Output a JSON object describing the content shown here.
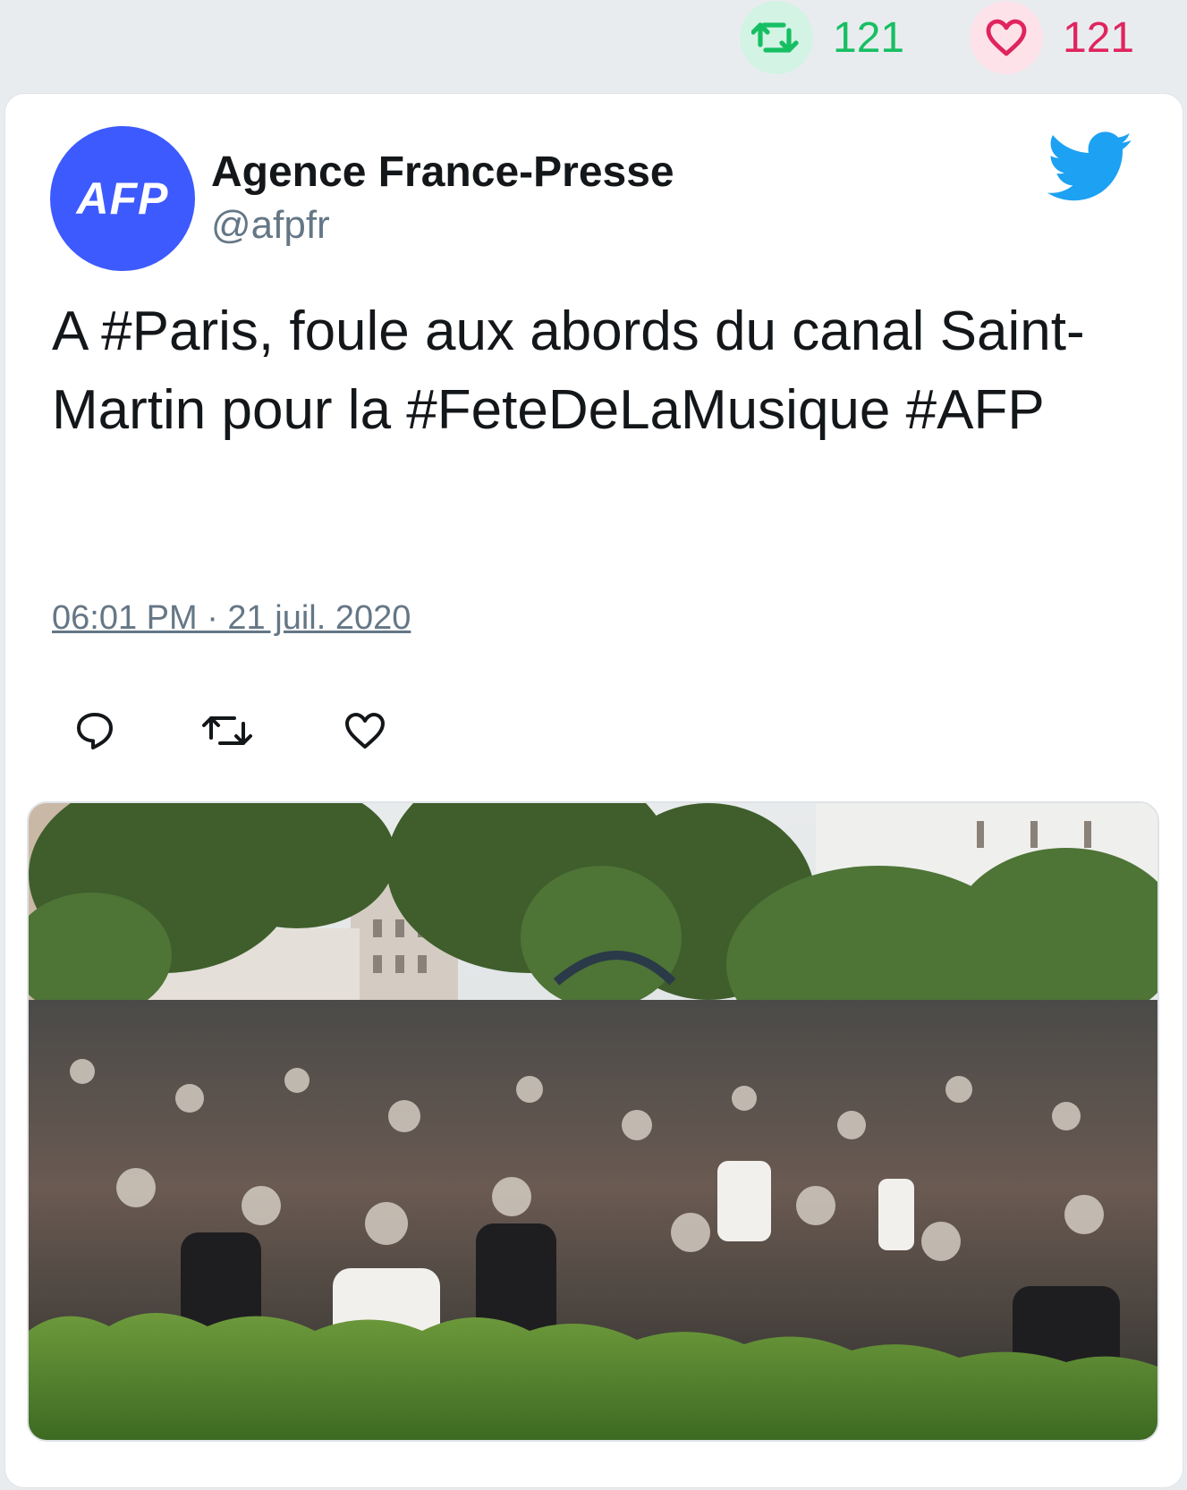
{
  "stats": {
    "retweets": "121",
    "likes": "121"
  },
  "tweet": {
    "author_name": "Agence France-Presse",
    "author_handle": "@afpfr",
    "avatar_text": "AFP",
    "text": "A #Paris, foule aux abords du canal Saint-Martin pour la #FeteDeLaMusique #AFP",
    "timestamp": "06:01 PM · 21 juil. 2020"
  },
  "icons": {
    "retweet": "retweet-icon",
    "like": "heart-icon",
    "reply": "reply-icon",
    "brand": "twitter-bird-icon"
  },
  "colors": {
    "retweet_green": "#17bf63",
    "like_red": "#e0245e",
    "avatar_blue": "#3d5afe",
    "twitter_blue": "#1da1f2"
  }
}
